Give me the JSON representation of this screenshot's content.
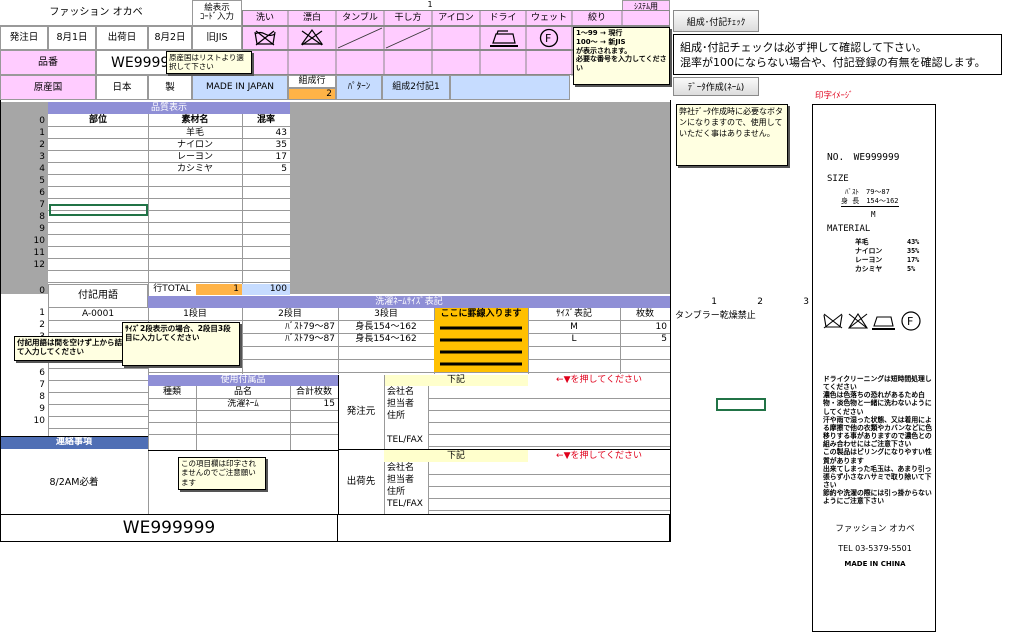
{
  "header": {
    "company": "ファッション オカベ",
    "display_code_label": "絵表示\nｺｰﾄﾞ入力",
    "number_1": "1",
    "system_label": "ｼｽﾃﾑ用",
    "care_headers": [
      "洗い",
      "漂白",
      "タンブル",
      "干し方",
      "アイロン",
      "ドライ",
      "ウェット",
      "絞り"
    ],
    "order_date_label": "発注日",
    "order_date": "8月1日",
    "ship_date_label": "出荷日",
    "ship_date": "8月2日",
    "standard": "旧JIS",
    "product_no_label": "品番",
    "product_no": "WE99999",
    "origin_label": "原産国",
    "origin": "日本",
    "made_label": "製",
    "made_in": "MADE IN JAPAN",
    "composition_row_label": "組成行",
    "composition_row_value": "2",
    "pattern_label": "ﾊﾟﾀｰﾝ",
    "composition_note_label": "組成2付記1"
  },
  "notes": {
    "origin_tip": "原産国はリストより選択して下さい",
    "system_tip": "1～99 → 現行\n100～ → 新JIS\nが表示されます。\n必要な番号を入力してください",
    "data_tip": "弊社ﾃﾞｰﾀ作成時に必要なボタンになりますので、使用していただく事はありません。",
    "note_tip": "付記用語は間を空けず上から詰めて入力してください",
    "size_tip": "ｻｲｽﾞ2段表示の場合、2段目3段目に入力してください",
    "print_tip": "この項目欄は印字されませんのでご注意願います"
  },
  "buttons": {
    "check": "組成･付記ﾁｪｯｸ",
    "data_create": "ﾃﾞｰﾀ作成(ﾈｰﾑ)"
  },
  "message": {
    "line1": "組成･付記チェックは必ず押して確認して下さい。",
    "line2": "混率が100にならない場合や、付記登録の有無を確認します。"
  },
  "quality": {
    "title": "品質表示",
    "col_part": "部位",
    "col_material": "素材名",
    "col_ratio": "混率",
    "rows": [
      {
        "material": "羊毛",
        "ratio": "43"
      },
      {
        "material": "ナイロン",
        "ratio": "35"
      },
      {
        "material": "レーヨン",
        "ratio": "17"
      },
      {
        "material": "カシミヤ",
        "ratio": "5"
      }
    ],
    "row_nums": [
      "0",
      "1",
      "2",
      "3",
      "4",
      "5",
      "6",
      "7",
      "8",
      "9",
      "10",
      "11",
      "12"
    ],
    "total_label": "行TOTAL",
    "total_rows": "1",
    "total_value": "100"
  },
  "notes_table": {
    "title": "付記用語",
    "row_nums": [
      "0",
      "1",
      "2",
      "3",
      "4",
      "5",
      "6",
      "7",
      "8",
      "9",
      "10"
    ],
    "first": "A-0001"
  },
  "size_table": {
    "title": "洗濯ﾈｰﾑｻｲｽﾞ表記",
    "col1": "1段目",
    "col2": "2段目",
    "col3": "3段目",
    "col4": "ここに罫線入ります",
    "col5": "ｻｲｽﾞ表記",
    "col6": "枚数",
    "rows": [
      {
        "c2": "ﾊﾞｽﾄ79～87",
        "c3": "身長154～162",
        "size": "M",
        "qty": "10"
      },
      {
        "c2": "ﾊﾞｽﾄ79～87",
        "c3": "身長154～162",
        "size": "L",
        "qty": "5"
      }
    ]
  },
  "right_extra": {
    "cols": [
      "1",
      "2",
      "3"
    ],
    "value": "タンブラー乾燥禁止"
  },
  "accessories": {
    "title": "使用付属品",
    "col_type": "種類",
    "col_name": "品名",
    "col_qty": "合計枚数",
    "rows": [
      {
        "name": "洗濯ﾈｰﾑ",
        "qty": "15"
      }
    ]
  },
  "sender": {
    "label": "発注元",
    "header": "下記",
    "hint": "←▼を押してください",
    "fields": [
      "会社名",
      "担当者",
      "住所",
      "",
      "TEL/FAX"
    ]
  },
  "receiver": {
    "label": "出荷先",
    "header": "下記",
    "hint": "←▼を押してください",
    "fields": [
      "会社名",
      "担当者",
      "住所",
      "TEL/FAX"
    ]
  },
  "contact": {
    "title": "連絡事項",
    "text": "8/2AM必着"
  },
  "footer_no": "WE999999",
  "print_image": {
    "title": "印字ｲﾒｰｼﾞ",
    "no": "NO.　WE999999",
    "size_label": "SIZE",
    "size_line1": "ﾊﾞｽﾄ　79～87",
    "size_line2": "身 長　154～162",
    "size_value": "M",
    "material_label": "MATERIAL",
    "materials": [
      {
        "name": "羊毛",
        "ratio": "43%"
      },
      {
        "name": "ナイロン",
        "ratio": "35%"
      },
      {
        "name": "レーヨン",
        "ratio": "17%"
      },
      {
        "name": "カシミヤ",
        "ratio": "5%"
      }
    ],
    "care_text": "ドライクリーニングは短時間処理してください\n濃色は色落ちの恐れがあるため白物・淡色物と一緒に洗わないようにしてください\n汗や雨で湿った状態、又は着用による摩擦で他の衣類やカバンなどに色移りする事がありますので濃色との組み合わせにはご注意下さい\nこの製品はピリングになりやすい性質があります\n出来てしまった毛玉は、あまり引っ張らず小さなハサミで取り除いて下さい\n節約や洗濯の際には引っ掛からないようにご注意下さい",
    "company": "ファッション オカベ",
    "tel": "TEL 03-5379-5501",
    "made": "MADE IN CHINA"
  }
}
